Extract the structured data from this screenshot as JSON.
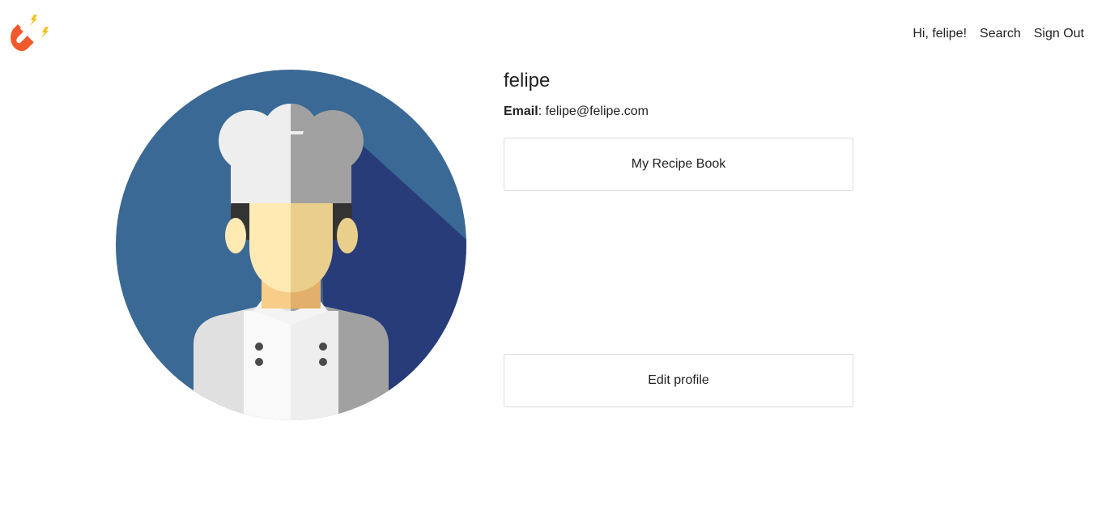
{
  "header": {
    "logo_icon": "magnet-icon",
    "nav": {
      "greeting": "Hi, felipe!",
      "search": "Search",
      "sign_out": "Sign Out"
    }
  },
  "profile": {
    "avatar_icon": "chef-avatar-icon",
    "username": "felipe",
    "email_label": "Email",
    "email_separator": ": ",
    "email_value": "felipe@felipe.com",
    "recipe_book_button": "My Recipe Book",
    "edit_profile_button": "Edit profile"
  },
  "colors": {
    "avatar_bg": "#3a6995",
    "avatar_shadow": "#283c7a",
    "hat_light": "#eeeeee",
    "hat_dark": "#a1a1a1",
    "skin_light": "#ffeab3",
    "skin_dark": "#e9cf8b",
    "logo_red": "#f15a2b",
    "logo_yellow": "#f7c11a"
  }
}
